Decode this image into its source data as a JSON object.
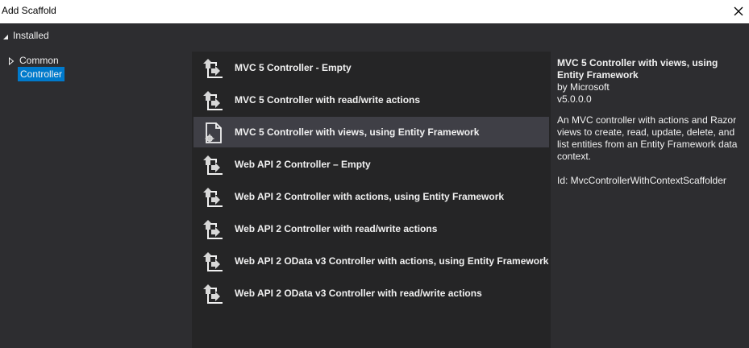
{
  "window": {
    "title": "Add Scaffold"
  },
  "tree": {
    "root_label": "Installed",
    "items": [
      {
        "label": "Common",
        "expanded": false
      },
      {
        "label": "Controller",
        "selected": true
      }
    ]
  },
  "scaffolds": {
    "items": [
      {
        "label": "MVC 5 Controller - Empty",
        "icon": "controller-icon"
      },
      {
        "label": "MVC 5 Controller with read/write actions",
        "icon": "controller-icon"
      },
      {
        "label": "MVC 5 Controller with views, using Entity Framework",
        "icon": "document-gear-icon",
        "selected": true
      },
      {
        "label": "Web API 2 Controller – Empty",
        "icon": "controller-icon"
      },
      {
        "label": "Web API 2 Controller with actions, using Entity Framework",
        "icon": "controller-icon"
      },
      {
        "label": "Web API 2 Controller with read/write actions",
        "icon": "controller-icon"
      },
      {
        "label": "Web API 2 OData v3 Controller with actions, using Entity Framework",
        "icon": "controller-icon"
      },
      {
        "label": "Web API 2 OData v3 Controller with read/write actions",
        "icon": "controller-icon"
      }
    ]
  },
  "details": {
    "title": "MVC 5 Controller with views, using Entity Framework",
    "author": "by Microsoft",
    "version": "v5.0.0.0",
    "description": "An MVC controller with actions and Razor views to create, read, update, delete, and list entities from an Entity Framework data context.",
    "id": "Id: MvcControllerWithContextScaffolder"
  },
  "colors": {
    "background": "#2d2d30",
    "list_background": "#252526",
    "selection": "#3f3f46",
    "tree_selection": "#007acc",
    "text": "#f1f1f1"
  }
}
